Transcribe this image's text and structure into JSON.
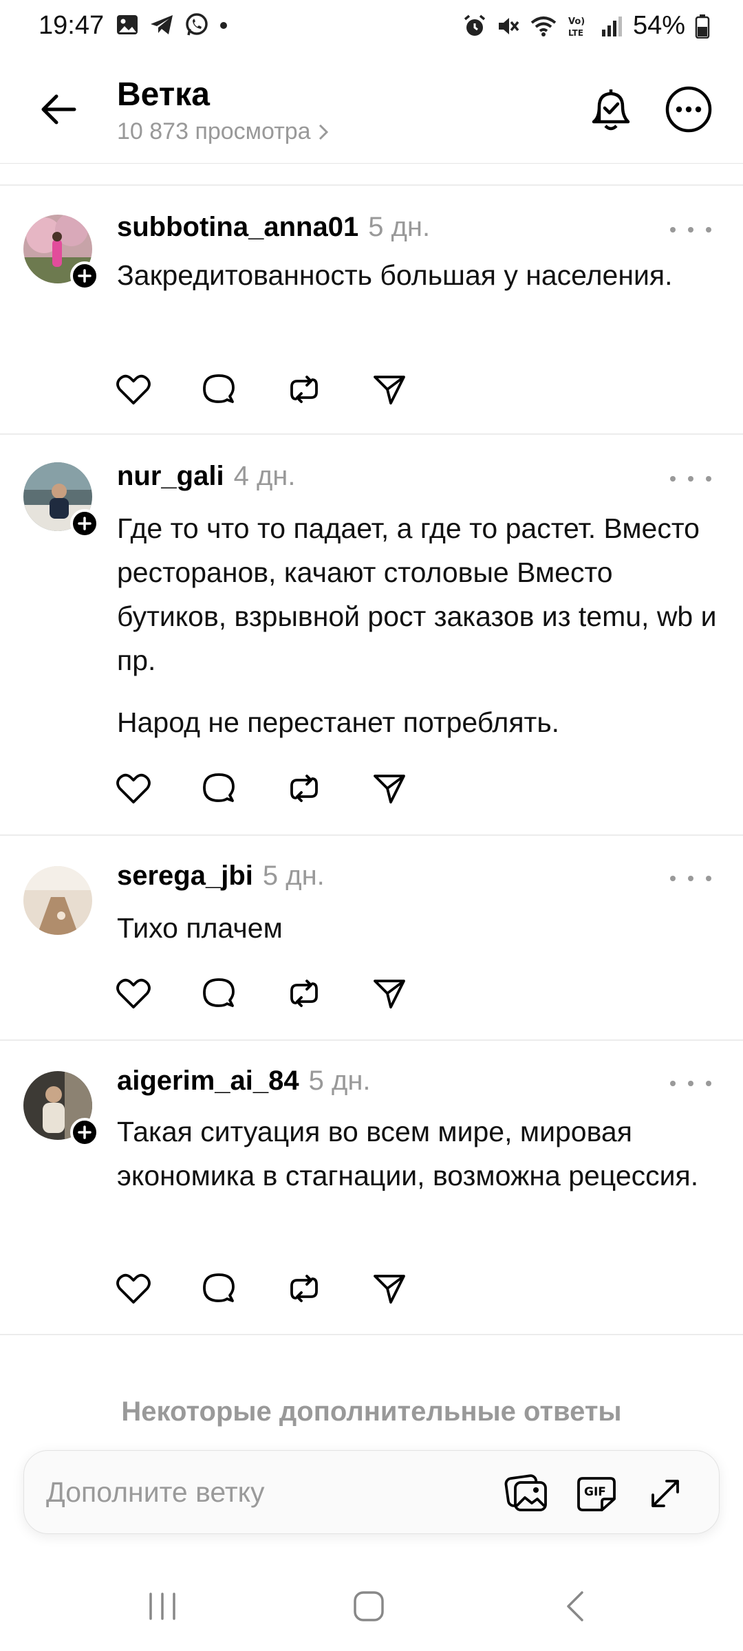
{
  "status_bar": {
    "time": "19:47",
    "battery": "54%",
    "left_icons": [
      "gallery-icon",
      "telegram-icon",
      "whatsapp-icon",
      "dot-icon"
    ],
    "right_icons": [
      "alarm-icon",
      "mute-icon",
      "wifi-icon",
      "volte-icon",
      "signal-icon",
      "battery-icon"
    ]
  },
  "header": {
    "title": "Ветка",
    "views": "10 873 просмотра",
    "back_icon": "arrow-left-icon",
    "bell_icon": "bell-check-icon",
    "more_icon": "more-circle-icon"
  },
  "posts": [
    {
      "username": "subbotina_anna01",
      "time": "5 дн.",
      "paragraphs": [
        "Закредитованность большая у населения."
      ],
      "follow_badge": true
    },
    {
      "username": "nur_gali",
      "time": "4 дн.",
      "paragraphs": [
        "Где то что то падает, а где то растет. Вместо ресторанов, качают столовые Вместо бутиков, взрывной рост заказов из temu, wb и пр.",
        "Народ не перестанет потреблять."
      ],
      "follow_badge": true
    },
    {
      "username": "serega_jbi",
      "time": "5 дн.",
      "paragraphs": [
        "Тихо плачем"
      ],
      "follow_badge": false
    },
    {
      "username": "aigerim_ai_84",
      "time": "5 дн.",
      "paragraphs": [
        "Такая ситуация во всем мире, мировая экономика в стагнации, возможна рецессия."
      ],
      "follow_badge": true
    }
  ],
  "post_actions": [
    "like-icon",
    "reply-icon",
    "repost-icon",
    "share-icon"
  ],
  "more_replies": "Некоторые дополнительные ответы",
  "composer": {
    "placeholder": "Дополните ветку",
    "buttons": [
      "image-icon",
      "gif-icon",
      "expand-icon"
    ]
  },
  "nav_bar": [
    "recents-icon",
    "home-icon",
    "back-nav-icon"
  ],
  "colors": {
    "text": "#000000",
    "secondary": "#999999",
    "divider": "#ececec",
    "background": "#ffffff"
  }
}
